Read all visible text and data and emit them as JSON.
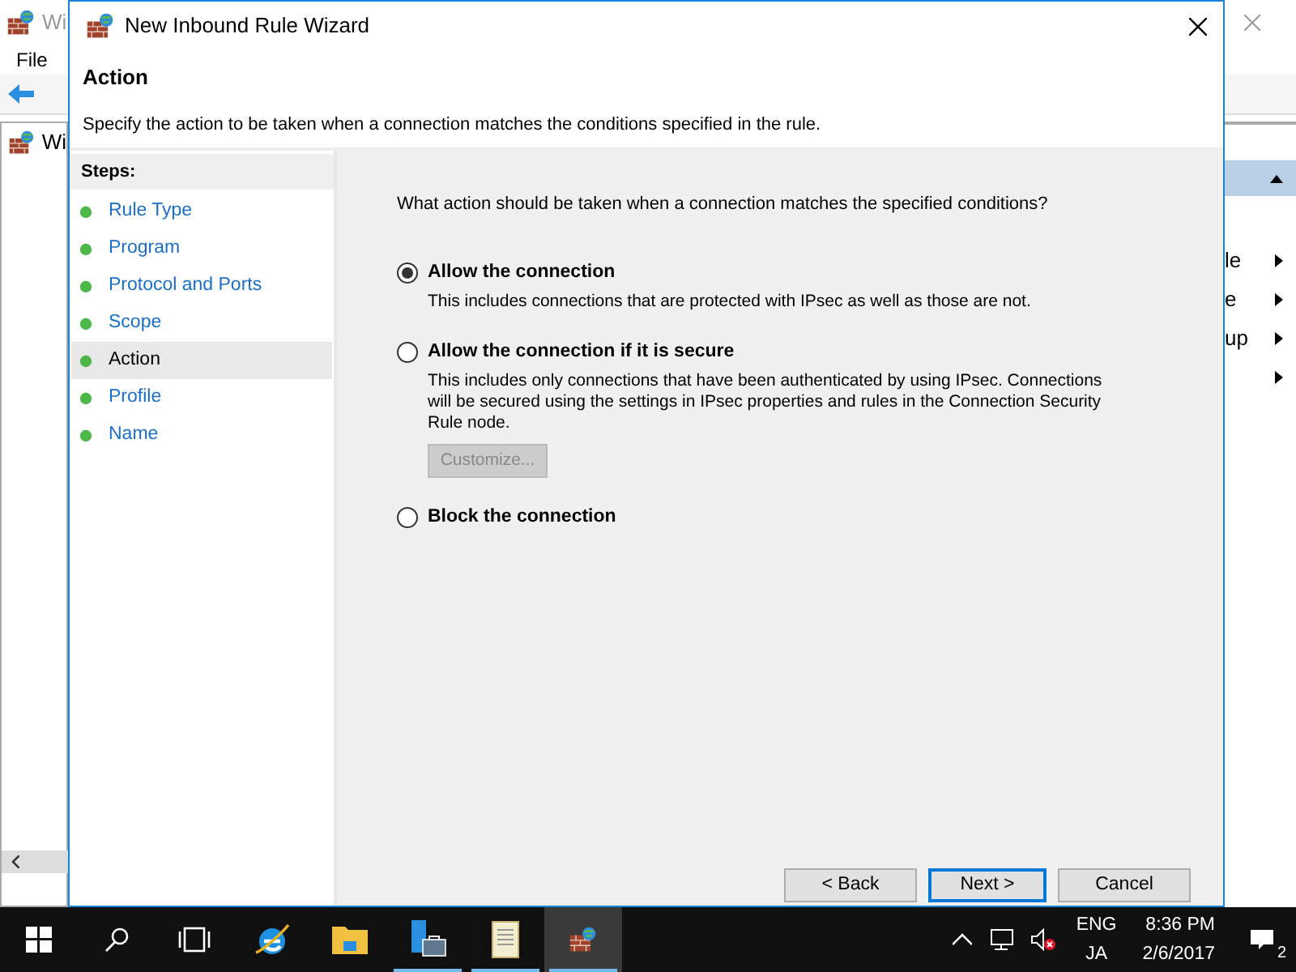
{
  "background_window": {
    "title": "Wi",
    "menu": [
      "File"
    ],
    "tree_item": "Wi",
    "actions": [
      "le",
      "e",
      "up"
    ]
  },
  "wizard": {
    "title": "New Inbound Rule Wizard",
    "header": "Action",
    "subtitle": "Specify the action to be taken when a connection matches the conditions specified in the rule.",
    "steps_heading": "Steps:",
    "steps": [
      {
        "label": "Rule Type",
        "selected": false
      },
      {
        "label": "Program",
        "selected": false
      },
      {
        "label": "Protocol and Ports",
        "selected": false
      },
      {
        "label": "Scope",
        "selected": false
      },
      {
        "label": "Action",
        "selected": true
      },
      {
        "label": "Profile",
        "selected": false
      },
      {
        "label": "Name",
        "selected": false
      }
    ],
    "question": "What action should be taken when a connection matches the specified conditions?",
    "options": [
      {
        "label": "Allow the connection",
        "selected": true,
        "description": "This includes connections that are protected with IPsec as well as those are not."
      },
      {
        "label": "Allow the connection if it is secure",
        "selected": false,
        "description": "This includes only connections that have been authenticated by using IPsec.  Connections will be secured using the settings in IPsec properties and rules in the Connection Security Rule node.",
        "button": {
          "label": "Customize...",
          "disabled": true
        }
      },
      {
        "label": "Block the connection",
        "selected": false
      }
    ],
    "buttons": [
      {
        "label": "< Back",
        "default": false
      },
      {
        "label": "Next >",
        "default": true
      },
      {
        "label": "Cancel",
        "default": false
      }
    ]
  },
  "taskbar": {
    "apps": [
      {
        "kind": "start",
        "running": false,
        "selected": false
      },
      {
        "kind": "search",
        "running": false,
        "selected": false
      },
      {
        "kind": "taskview",
        "running": false,
        "selected": false
      },
      {
        "kind": "ie",
        "running": false,
        "selected": false
      },
      {
        "kind": "explorer",
        "running": false,
        "selected": false
      },
      {
        "kind": "server",
        "running": true,
        "selected": false
      },
      {
        "kind": "notepad",
        "running": true,
        "selected": false
      },
      {
        "kind": "firewall",
        "running": true,
        "selected": true
      }
    ],
    "language": [
      "ENG",
      "JA"
    ],
    "time": "8:36 PM",
    "date": "2/6/2017",
    "notifications": "2"
  }
}
